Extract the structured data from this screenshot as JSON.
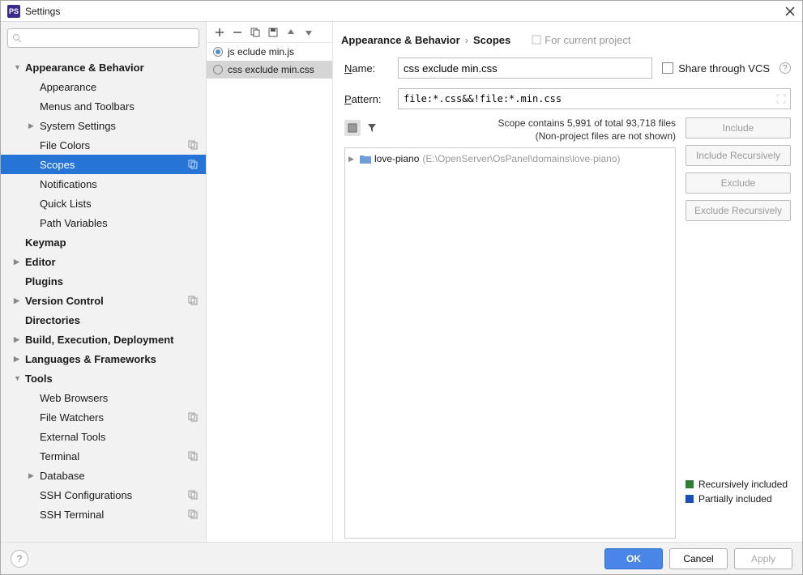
{
  "window": {
    "title": "Settings",
    "app_icon": "PS"
  },
  "search": {
    "placeholder": ""
  },
  "sidebar": [
    {
      "label": "Appearance & Behavior",
      "level": 1,
      "expandable": true,
      "open": true
    },
    {
      "label": "Appearance",
      "level": 2
    },
    {
      "label": "Menus and Toolbars",
      "level": 2
    },
    {
      "label": "System Settings",
      "level": 2,
      "expandable": true
    },
    {
      "label": "File Colors",
      "level": 2,
      "badge": true
    },
    {
      "label": "Scopes",
      "level": 2,
      "badge": true,
      "selected": true
    },
    {
      "label": "Notifications",
      "level": 2
    },
    {
      "label": "Quick Lists",
      "level": 2
    },
    {
      "label": "Path Variables",
      "level": 2
    },
    {
      "label": "Keymap",
      "level": 1
    },
    {
      "label": "Editor",
      "level": 1,
      "expandable": true
    },
    {
      "label": "Plugins",
      "level": 1
    },
    {
      "label": "Version Control",
      "level": 1,
      "expandable": true,
      "badge": true
    },
    {
      "label": "Directories",
      "level": 1
    },
    {
      "label": "Build, Execution, Deployment",
      "level": 1,
      "expandable": true
    },
    {
      "label": "Languages & Frameworks",
      "level": 1,
      "expandable": true
    },
    {
      "label": "Tools",
      "level": 1,
      "expandable": true,
      "open": true
    },
    {
      "label": "Web Browsers",
      "level": 2
    },
    {
      "label": "File Watchers",
      "level": 2,
      "badge": true
    },
    {
      "label": "External Tools",
      "level": 2
    },
    {
      "label": "Terminal",
      "level": 2,
      "badge": true
    },
    {
      "label": "Database",
      "level": 2,
      "expandable": true
    },
    {
      "label": "SSH Configurations",
      "level": 2,
      "badge": true
    },
    {
      "label": "SSH Terminal",
      "level": 2,
      "badge": true
    }
  ],
  "breadcrumb": {
    "a": "Appearance & Behavior",
    "b": "Scopes",
    "context": "For current project"
  },
  "scopes_list": [
    {
      "label": "js eclude min.js",
      "selected": false
    },
    {
      "label": "css exclude min.css",
      "selected": true
    }
  ],
  "form": {
    "name_label": "Name:",
    "name_value": "css exclude min.css",
    "pattern_label_pre": "P",
    "pattern_label_post": "attern:",
    "pattern_value": "file:*.css&&!file:*.min.css",
    "share_label": "Share through VCS"
  },
  "stats": {
    "line1": "Scope contains 5,991 of total 93,718 files",
    "line2": "(Non-project files are not shown)"
  },
  "tree": {
    "root_name": "love-piano",
    "root_path": "(E:\\OpenServer\\OsPanel\\domains\\love-piano)"
  },
  "actions": {
    "include": "Include",
    "include_rec": "Include Recursively",
    "exclude": "Exclude",
    "exclude_rec": "Exclude Recursively"
  },
  "legend": {
    "rec": "Recursively included",
    "rec_color": "#2e7d32",
    "part": "Partially included",
    "part_color": "#1a4fb5"
  },
  "footer": {
    "ok": "OK",
    "cancel": "Cancel",
    "apply": "Apply"
  }
}
